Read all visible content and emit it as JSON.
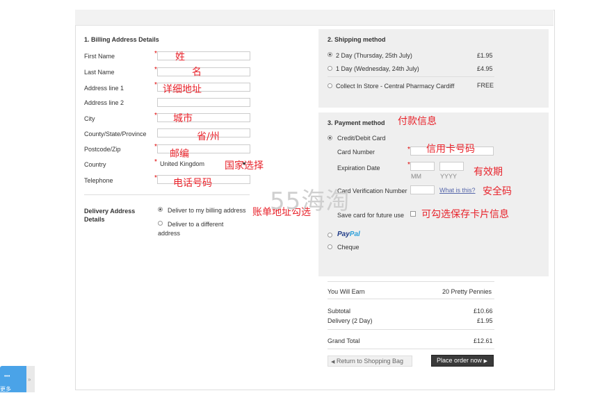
{
  "billing": {
    "title": "1. Billing Address Details",
    "fields": [
      {
        "label": "First Name",
        "required": true,
        "annotation": "姓"
      },
      {
        "label": "Last Name",
        "required": true,
        "annotation": "名"
      },
      {
        "label": "Address line 1",
        "required": true,
        "annotation": "详细地址"
      },
      {
        "label": "Address line 2",
        "required": false,
        "annotation": ""
      },
      {
        "label": "City",
        "required": true,
        "annotation": "城市"
      },
      {
        "label": "County/State/Province",
        "required": false,
        "annotation": "省/州"
      },
      {
        "label": "Postcode/Zip",
        "required": true,
        "annotation": "邮编"
      },
      {
        "label": "Country",
        "required": true,
        "value": "United Kingdom",
        "annotation": "国家选择"
      },
      {
        "label": "Telephone",
        "required": true,
        "annotation": "电话号码"
      }
    ]
  },
  "delivery": {
    "title": "Delivery Address Details",
    "option_billing": "Deliver to my billing address",
    "option_different_1": "Deliver to a different",
    "option_different_2": "address",
    "selected": "billing",
    "annotation": "账单地址勾选"
  },
  "shipping": {
    "title": "2. Shipping method",
    "options": [
      {
        "label": "2 Day (Thursday, 25th July)",
        "price": "£1.95",
        "selected": true
      },
      {
        "label": "1 Day (Wednesday, 24th July)",
        "price": "£4.95",
        "selected": false
      },
      {
        "label": "Collect In Store - Central Pharmacy Cardiff",
        "price": "FREE",
        "selected": false
      }
    ]
  },
  "payment": {
    "title": "3. Payment method",
    "title_annotation": "付款信息",
    "card_option": "Credit/Debit Card",
    "card_number_label": "Card Number",
    "card_number_annotation": "信用卡号码",
    "expiry_label": "Expiration Date",
    "expiry_mm": "MM",
    "expiry_yyyy": "YYYY",
    "expiry_annotation": "有效期",
    "cvn_label": "Card Verification Number",
    "cvn_link": "What is this?",
    "cvn_annotation": "安全码",
    "save_label": "Save card for future use",
    "save_annotation": "可勾选保存卡片信息",
    "paypal_1": "Pay",
    "paypal_2": "Pal",
    "cheque": "Cheque"
  },
  "summary": {
    "earn_label": "You Will Earn",
    "earn_value": "20 Pretty Pennies",
    "subtotal_label": "Subtotal",
    "subtotal_value": "£10.66",
    "delivery_label": "Delivery (2 Day)",
    "delivery_value": "£1.95",
    "total_label": "Grand Total",
    "total_value": "£12.61"
  },
  "buttons": {
    "back": "Return to Shopping Bag",
    "order": "Place order now"
  },
  "watermark": "55海淘",
  "widget": {
    "dots": "•••",
    "text": "更多"
  },
  "colors": {
    "annotation": "#e8232b",
    "panel": "#efefef",
    "order_button": "#3a3a3a"
  }
}
